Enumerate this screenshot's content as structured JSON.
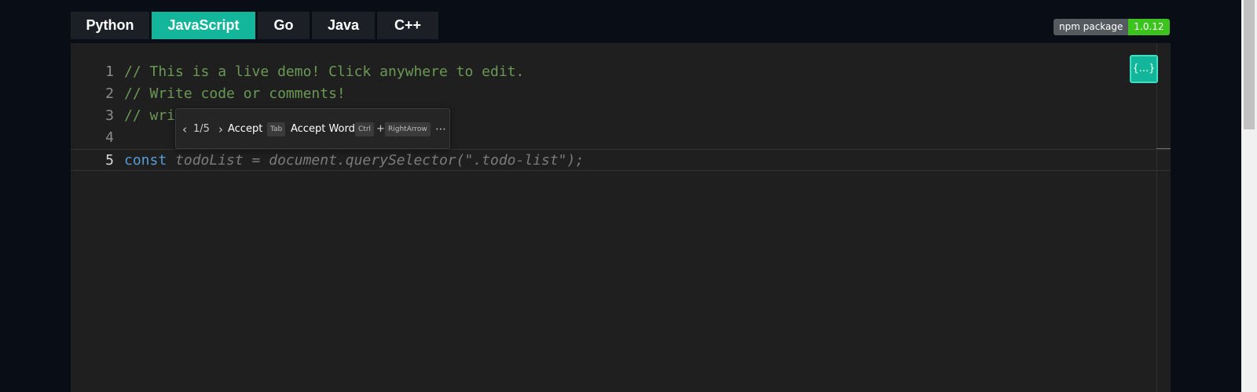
{
  "tabs": [
    {
      "label": "Python"
    },
    {
      "label": "JavaScript"
    },
    {
      "label": "Go"
    },
    {
      "label": "Java"
    },
    {
      "label": "C++"
    }
  ],
  "active_tab": "JavaScript",
  "badge": {
    "label": "npm package",
    "version": "1.0.12"
  },
  "editor": {
    "lines": [
      {
        "number": "1",
        "text": "// This is a live demo! Click anywhere to edit."
      },
      {
        "number": "2",
        "text": "// Write code or comments!"
      },
      {
        "number": "3",
        "text": "// wri"
      },
      {
        "number": "4",
        "text": ""
      },
      {
        "number": "5",
        "keyword": "const",
        "ghost": " todoList = document.querySelector(\".todo-list\");"
      }
    ],
    "format_button": "{...}"
  },
  "suggestion": {
    "counter": "1/5",
    "accept": "Accept",
    "accept_key": "Tab",
    "accept_word": "Accept Word",
    "accept_word_key1": "Ctrl",
    "plus": "+",
    "accept_word_key2": "RightArrow",
    "more": "⋯"
  },
  "colors": {
    "accent": "#13b59b",
    "badge_version": "#3cc31e",
    "comment": "#6a9955",
    "keyword": "#569cd6"
  }
}
